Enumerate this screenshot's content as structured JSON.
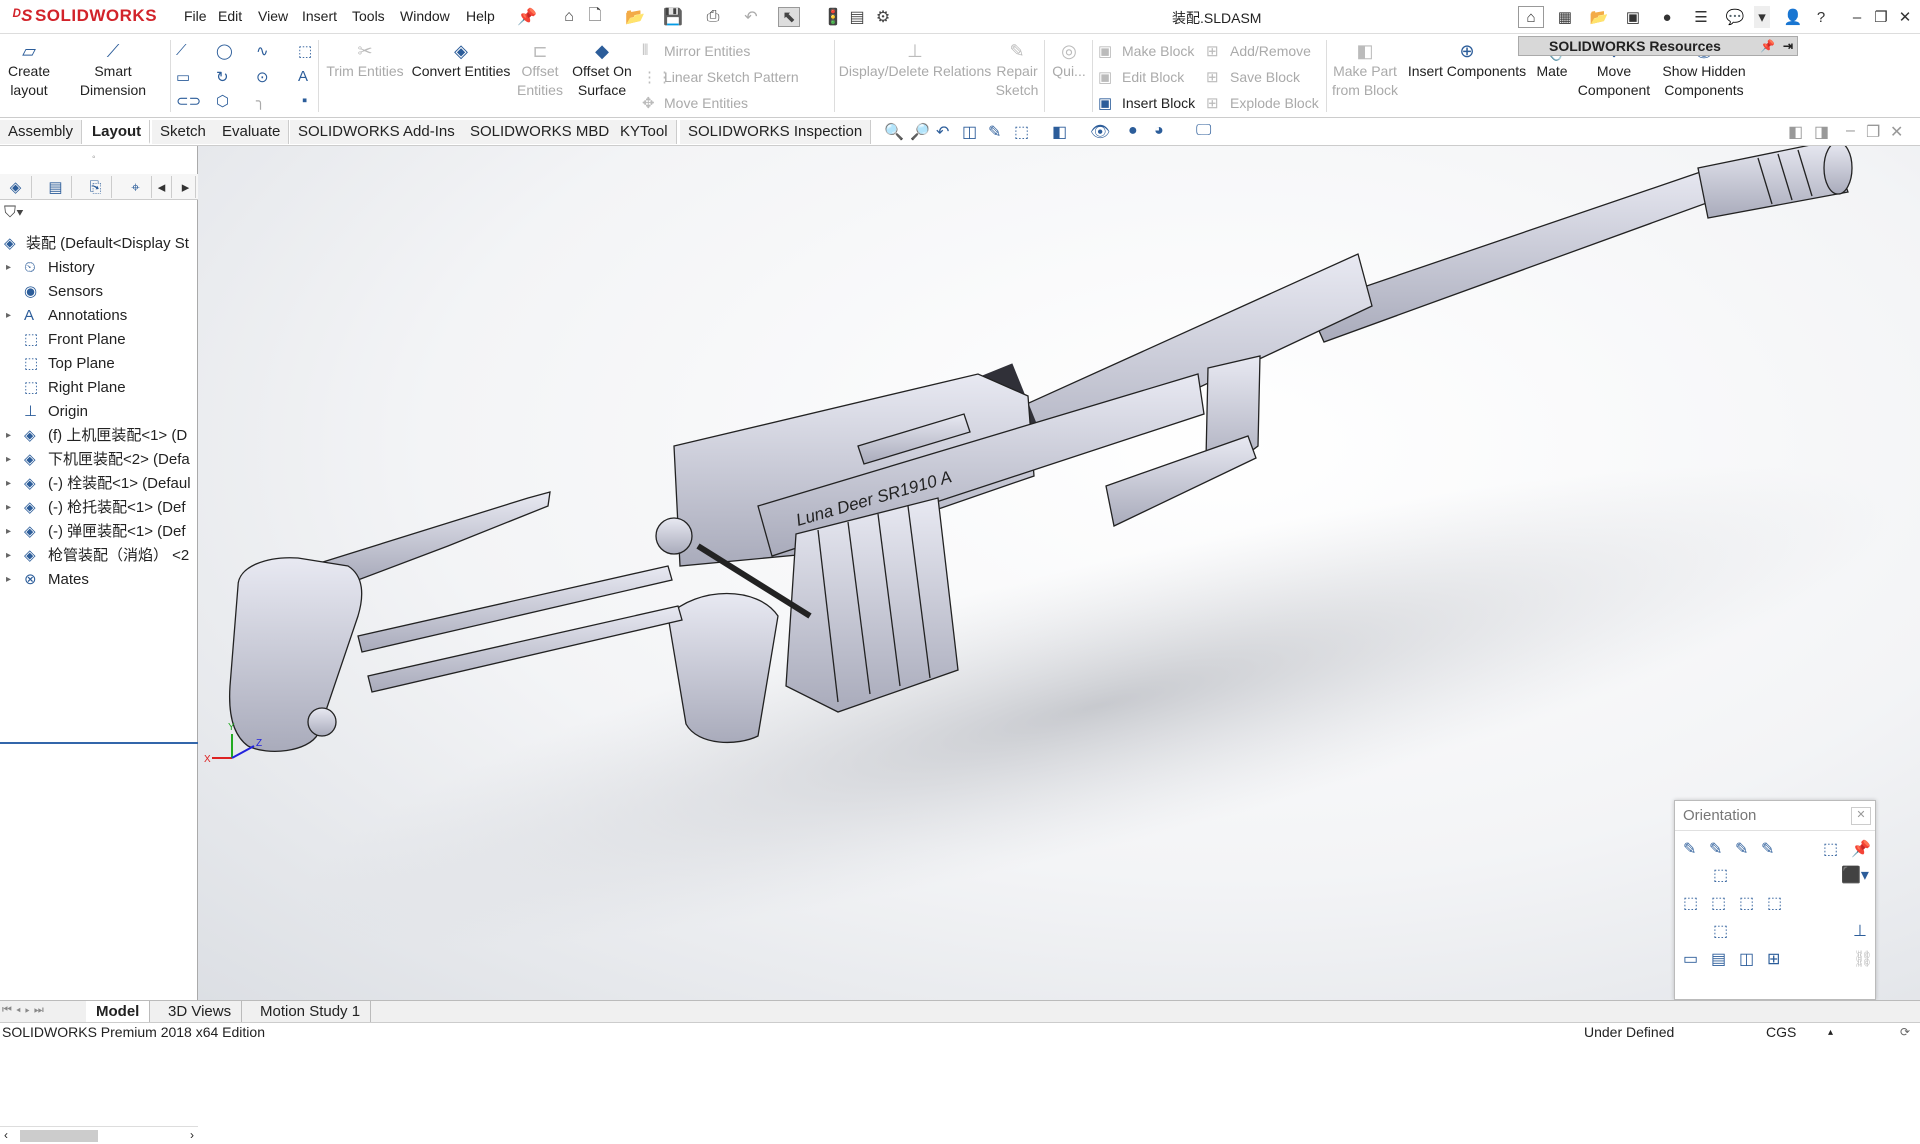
{
  "app": {
    "brand": "SOLIDWORKS",
    "doc_title": "装配.SLDASM"
  },
  "menu": [
    "File",
    "Edit",
    "View",
    "Insert",
    "Tools",
    "Window",
    "Help"
  ],
  "resources_label": "SOLIDWORKS Resources",
  "commands": {
    "create_layout": [
      "Create",
      "layout"
    ],
    "smart_dimension": "Smart Dimension",
    "trim_entities": "Trim Entities",
    "convert_entities": "Convert Entities",
    "offset_entities": [
      "Offset",
      "Entities"
    ],
    "offset_on_surface": [
      "Offset On",
      "Surface"
    ],
    "mirror_entities": "Mirror Entities",
    "linear_sketch_pattern": "Linear Sketch Pattern",
    "move_entities": "Move Entities",
    "display_delete_relations": "Display/Delete Relations",
    "repair_sketch": [
      "Repair",
      "Sketch"
    ],
    "quick_snaps": "Qui...",
    "make_block": "Make Block",
    "edit_block": "Edit Block",
    "insert_block": "Insert Block",
    "add_remove": "Add/Remove",
    "save_block": "Save Block",
    "explode_block": "Explode Block",
    "make_part_from_block": [
      "Make Part",
      "from Block"
    ],
    "insert_components": "Insert Components",
    "mate": "Mate",
    "move_component": [
      "Move",
      "Component"
    ],
    "show_hidden_components": [
      "Show Hidden",
      "Components"
    ]
  },
  "tabs": [
    "Assembly",
    "Layout",
    "Sketch",
    "Evaluate",
    "SOLIDWORKS Add-Ins",
    "SOLIDWORKS MBD",
    "KYTool",
    "SOLIDWORKS Inspection"
  ],
  "active_tab": "Layout",
  "tree": {
    "root": "装配  (Default<Display St",
    "items": [
      {
        "label": "History",
        "icon": "history-icon",
        "expandable": true
      },
      {
        "label": "Sensors",
        "icon": "sensor-icon",
        "expandable": false
      },
      {
        "label": "Annotations",
        "icon": "annotations-icon",
        "expandable": true
      },
      {
        "label": "Front Plane",
        "icon": "plane-icon",
        "expandable": false
      },
      {
        "label": "Top Plane",
        "icon": "plane-icon",
        "expandable": false
      },
      {
        "label": "Right Plane",
        "icon": "plane-icon",
        "expandable": false
      },
      {
        "label": "Origin",
        "icon": "origin-icon",
        "expandable": false
      },
      {
        "label": "(f) 上机匣装配<1> (D",
        "icon": "assembly-icon",
        "expandable": true
      },
      {
        "label": "下机匣装配<2> (Defa",
        "icon": "assembly-icon",
        "expandable": true
      },
      {
        "label": "(-) 栓装配<1> (Defaul",
        "icon": "assembly-icon",
        "expandable": true
      },
      {
        "label": "(-) 枪托装配<1> (Def",
        "icon": "assembly-icon",
        "expandable": true
      },
      {
        "label": "(-) 弹匣装配<1> (Def",
        "icon": "assembly-icon",
        "expandable": true
      },
      {
        "label": "枪管装配（消焰） <2",
        "icon": "assembly-icon",
        "expandable": true
      },
      {
        "label": "Mates",
        "icon": "mates-icon",
        "expandable": true
      }
    ]
  },
  "model_engraving": "Luna Deer SR1910 A",
  "orientation": {
    "title": "Orientation"
  },
  "bottom_tabs": [
    "Model",
    "3D Views",
    "Motion Study 1"
  ],
  "active_bottom_tab": "Model",
  "status": {
    "edition": "SOLIDWORKS Premium 2018 x64 Edition",
    "state": "Under Defined",
    "units": "CGS"
  }
}
